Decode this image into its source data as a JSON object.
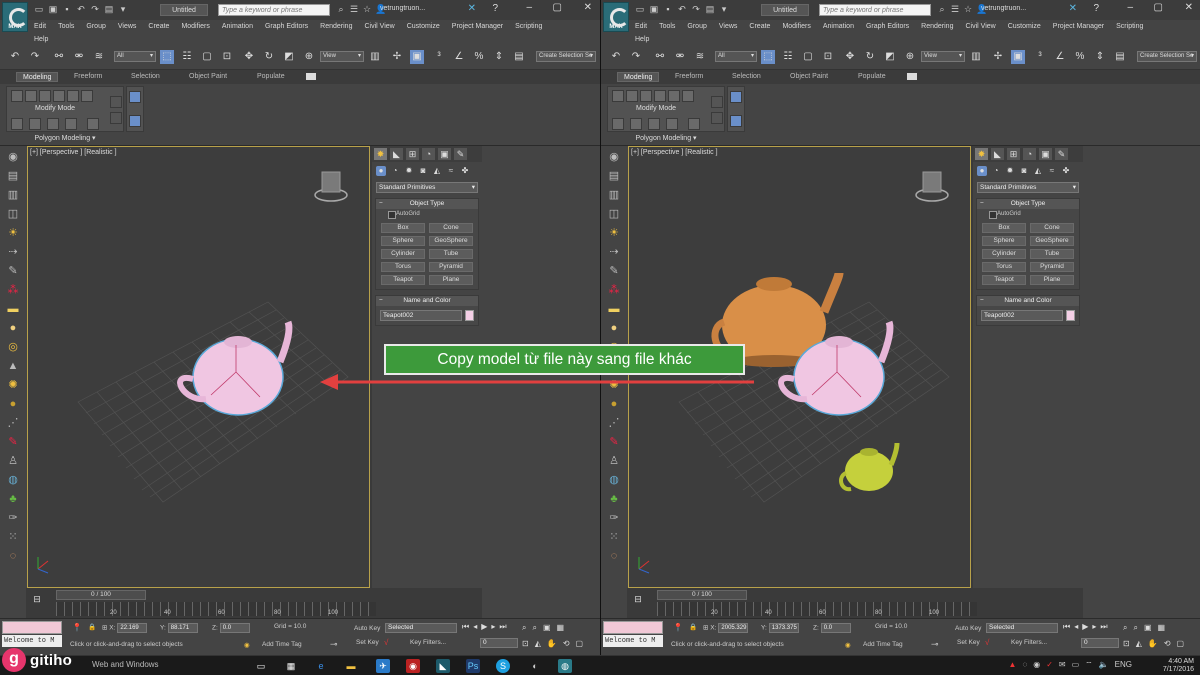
{
  "window": {
    "title": "Untitled",
    "search_placeholder": "Type a keyword or phrase",
    "user": "vetrungtruon..."
  },
  "menu": {
    "row1_left": [
      "Edit",
      "Tools",
      "Group",
      "Views",
      "Create",
      "Modifiers",
      "Animation",
      "Graph Editors",
      "Rendering",
      "Civil View",
      "Customize",
      "Project Manager",
      "Scripting"
    ],
    "row2_left": [
      "Help"
    ]
  },
  "toolbar": {
    "filter": "All",
    "view": "View",
    "selection_set": "Create Selection Se"
  },
  "ribbon": {
    "tabs": [
      "Modeling",
      "Freeform",
      "Selection",
      "Object Paint",
      "Populate"
    ],
    "mode": "Modify Mode",
    "footer": "Polygon Modeling ▾"
  },
  "viewport": {
    "label": "[+] [Perspective ] [Realistic ]"
  },
  "command": {
    "category": "Standard Primitives",
    "object_type": "Object Type",
    "autogrid": "AutoGrid",
    "primitives": [
      "Box",
      "Cone",
      "Sphere",
      "GeoSphere",
      "Cylinder",
      "Tube",
      "Torus",
      "Pyramid",
      "Teapot",
      "Plane"
    ],
    "name_and_color": "Name and Color",
    "object_name": "Teapot002",
    "object_color": "#f4cfe6"
  },
  "timeline": {
    "frame": "0 / 100",
    "ticks": [
      "20",
      "40",
      "60",
      "80",
      "100"
    ]
  },
  "status": {
    "welcome": "Welcome to M",
    "hint": "Click or click-and-drag to select objects",
    "grid": "Grid = 10.0",
    "z": "0.0",
    "auto_key": "Auto Key",
    "set_key": "Set Key",
    "selected": "Selected",
    "key_filters": "Key Filters...",
    "add_time_tag": "Add Time Tag",
    "frame_input": "0",
    "left_x": "22.169",
    "left_y": "88.171",
    "right_x": "2005.329",
    "right_y": "1373.375"
  },
  "callout": {
    "text": "Copy model từ file này sang file khác"
  },
  "taskbar": {
    "search": "Web and Windows",
    "lang": "ENG",
    "time": "4:40 AM",
    "date": "7/17/2016"
  },
  "brand": {
    "logo": "g",
    "name": "gitiho"
  },
  "colors": {
    "pink_teapot": "#f0c6e2",
    "orange_teapot": "#d98f48",
    "green_teapot": "#c5d03c",
    "callout_bg": "#3d9a3b",
    "arrow": "#e2403f"
  }
}
